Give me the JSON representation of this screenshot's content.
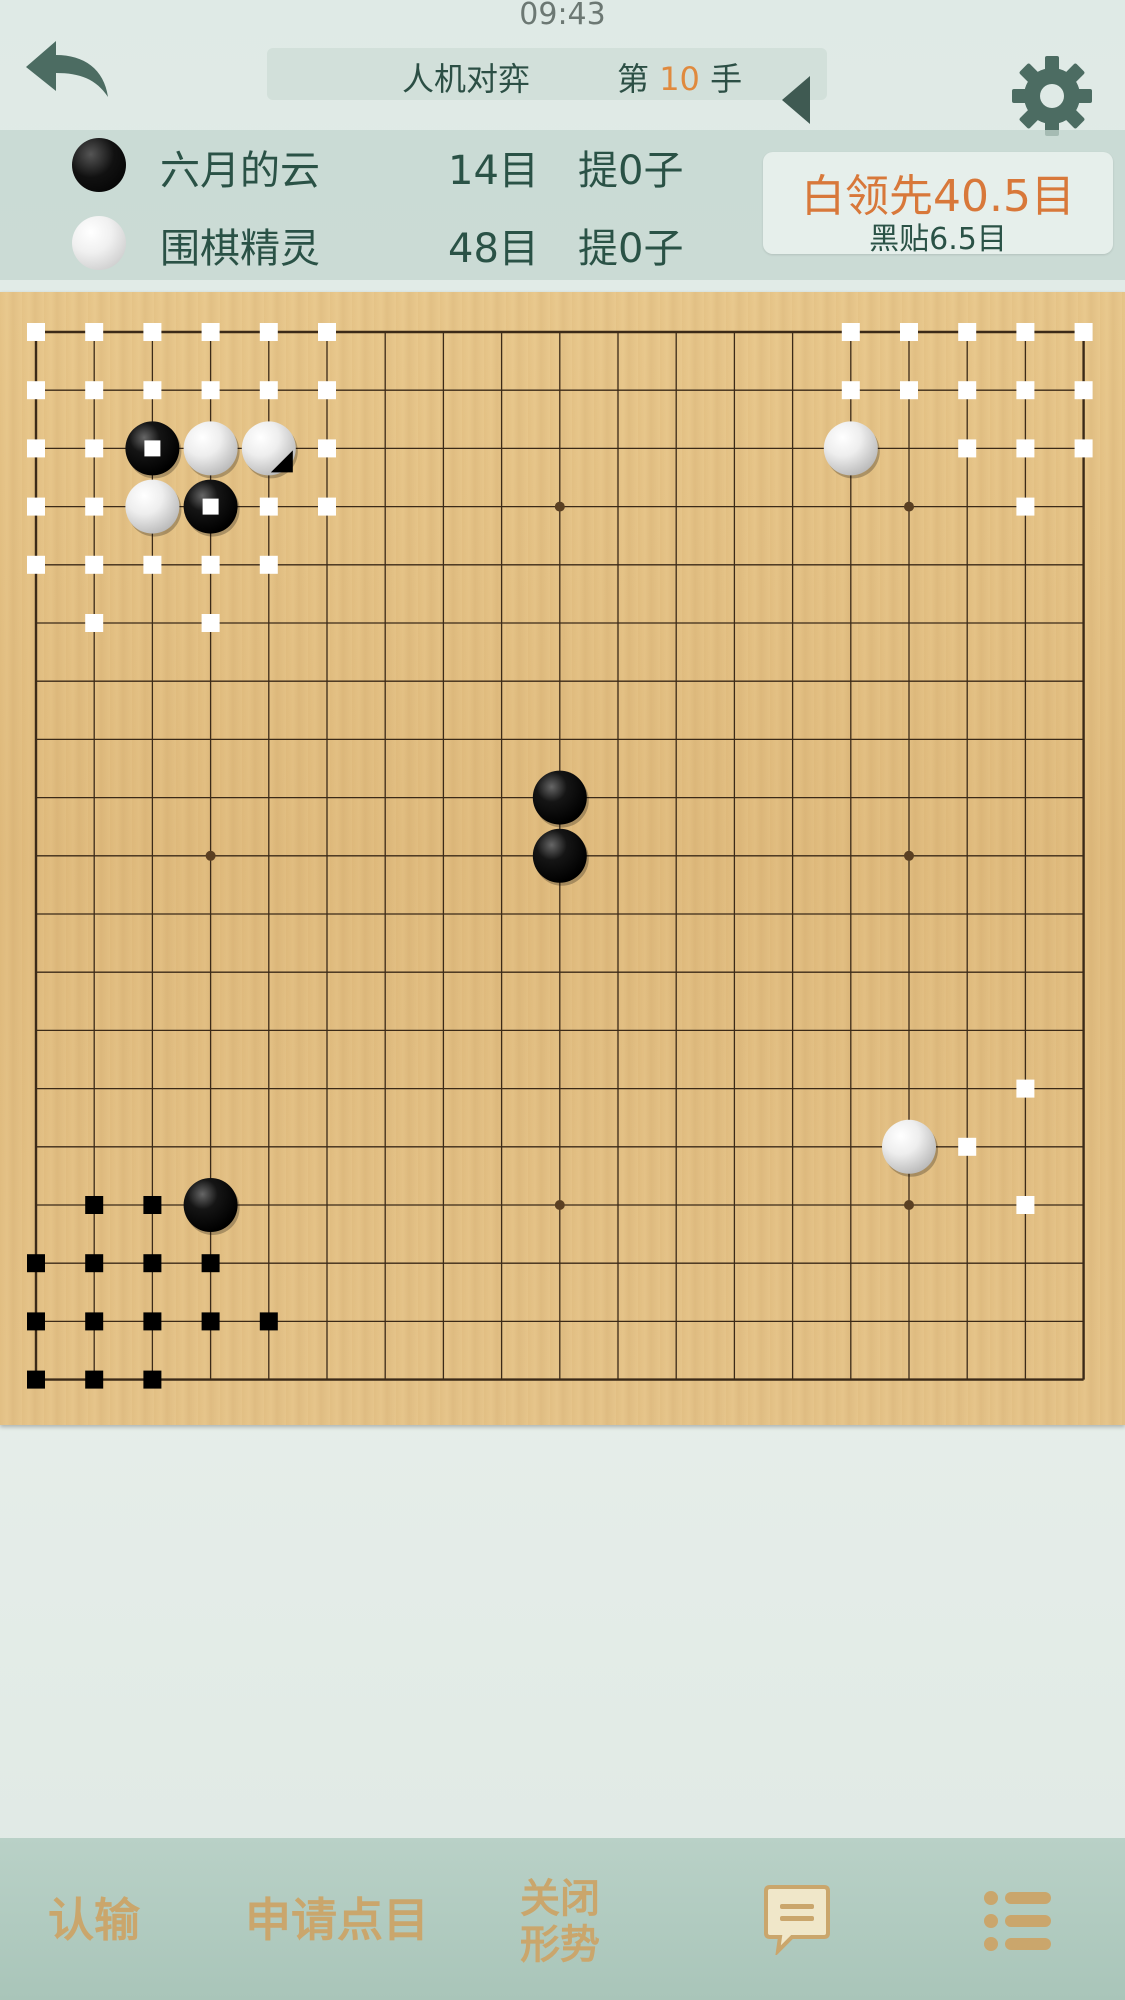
{
  "status": {
    "time": "09:43"
  },
  "header": {
    "mode": "人机对弈",
    "move_prefix": "第",
    "move_number": "10",
    "move_suffix": "手"
  },
  "players": [
    {
      "color": "black",
      "name": "六月的云",
      "score": "14目",
      "captures": "提0子"
    },
    {
      "color": "white",
      "name": "围棋精灵",
      "score": "48目",
      "captures": "提0子"
    }
  ],
  "lead": {
    "main": "白领先40.5目",
    "komi": "黑贴6.5目"
  },
  "board": {
    "size": 19,
    "stones": [
      {
        "col": 2,
        "row": 2,
        "color": "black",
        "marker": "white-square"
      },
      {
        "col": 3,
        "row": 2,
        "color": "white"
      },
      {
        "col": 4,
        "row": 2,
        "color": "white",
        "marker": "last-move"
      },
      {
        "col": 2,
        "row": 3,
        "color": "white"
      },
      {
        "col": 3,
        "row": 3,
        "color": "black",
        "marker": "white-square"
      },
      {
        "col": 14,
        "row": 2,
        "color": "white"
      },
      {
        "col": 9,
        "row": 8,
        "color": "black"
      },
      {
        "col": 9,
        "row": 9,
        "color": "black"
      },
      {
        "col": 3,
        "row": 15,
        "color": "black"
      },
      {
        "col": 15,
        "row": 14,
        "color": "white"
      }
    ],
    "territory_white": [
      [
        0,
        0
      ],
      [
        1,
        0
      ],
      [
        2,
        0
      ],
      [
        3,
        0
      ],
      [
        4,
        0
      ],
      [
        5,
        0
      ],
      [
        14,
        0
      ],
      [
        15,
        0
      ],
      [
        16,
        0
      ],
      [
        17,
        0
      ],
      [
        18,
        0
      ],
      [
        0,
        1
      ],
      [
        1,
        1
      ],
      [
        2,
        1
      ],
      [
        3,
        1
      ],
      [
        4,
        1
      ],
      [
        5,
        1
      ],
      [
        14,
        1
      ],
      [
        15,
        1
      ],
      [
        16,
        1
      ],
      [
        17,
        1
      ],
      [
        18,
        1
      ],
      [
        0,
        2
      ],
      [
        1,
        2
      ],
      [
        5,
        2
      ],
      [
        14,
        2
      ],
      [
        16,
        2
      ],
      [
        17,
        2
      ],
      [
        18,
        2
      ],
      [
        0,
        3
      ],
      [
        1,
        3
      ],
      [
        4,
        3
      ],
      [
        5,
        3
      ],
      [
        17,
        3
      ],
      [
        0,
        4
      ],
      [
        1,
        4
      ],
      [
        2,
        4
      ],
      [
        3,
        4
      ],
      [
        4,
        4
      ],
      [
        1,
        5
      ],
      [
        3,
        5
      ],
      [
        17,
        13
      ],
      [
        16,
        14
      ],
      [
        17,
        15
      ]
    ],
    "territory_black": [
      [
        1,
        15
      ],
      [
        2,
        15
      ],
      [
        0,
        16
      ],
      [
        1,
        16
      ],
      [
        2,
        16
      ],
      [
        3,
        16
      ],
      [
        0,
        17
      ],
      [
        1,
        17
      ],
      [
        2,
        17
      ],
      [
        3,
        17
      ],
      [
        4,
        17
      ],
      [
        0,
        18
      ],
      [
        1,
        18
      ],
      [
        2,
        18
      ]
    ],
    "star_points": [
      [
        9,
        3
      ],
      [
        15,
        3
      ],
      [
        3,
        9
      ],
      [
        15,
        9
      ],
      [
        9,
        15
      ],
      [
        15,
        15
      ]
    ]
  },
  "toolbar": {
    "resign": "认输",
    "count": "申请点目",
    "toggle_line1": "关闭",
    "toggle_line2": "形势",
    "chat_icon": "chat-icon",
    "menu_icon": "list-menu-icon"
  },
  "colors": {
    "accent": "#e08a3e",
    "text": "#2a5246",
    "toolbar_gold": "#caa66c"
  }
}
